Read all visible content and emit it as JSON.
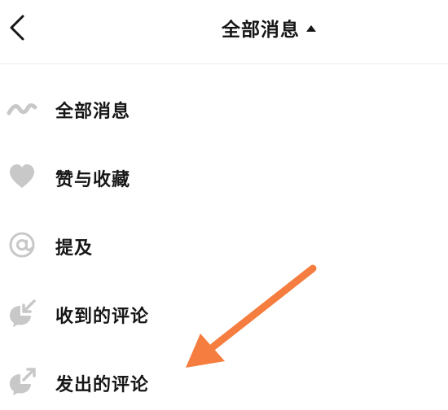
{
  "header": {
    "back_icon": "chevron-left-icon",
    "title": "全部消息",
    "title_caret_icon": "caret-up-icon"
  },
  "menu": {
    "items": [
      {
        "label": "全部消息",
        "icon": "wave-icon"
      },
      {
        "label": "赞与收藏",
        "icon": "heart-icon"
      },
      {
        "label": "提及",
        "icon": "at-icon"
      },
      {
        "label": "收到的评论",
        "icon": "comment-received-icon"
      },
      {
        "label": "发出的评论",
        "icon": "comment-sent-icon"
      }
    ]
  },
  "annotation": {
    "arrow_color": "#f47d3f"
  },
  "colors": {
    "text": "#161616",
    "icon": "#c8c8c8",
    "divider": "#ececec",
    "accent_arrow": "#f47d3f"
  }
}
